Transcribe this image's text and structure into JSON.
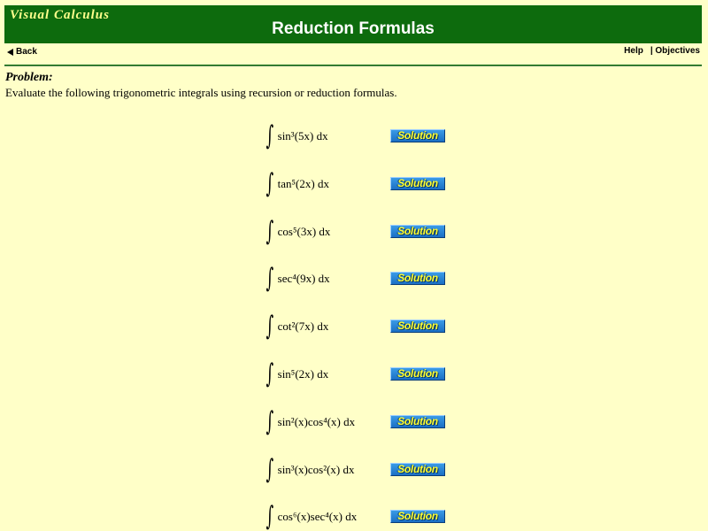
{
  "header": {
    "brand": "Visual Calculus",
    "title": "Reduction Formulas"
  },
  "nav": {
    "back_label": "Back",
    "help_label": "Help",
    "objectives_label": "| Objectives"
  },
  "problem": {
    "heading": "Problem:",
    "text": "Evaluate the following trigonometric integrals using recursion or reduction formulas."
  },
  "integrals": [
    {
      "integrand": "sin³(5x) dx",
      "solution_label": "Solution"
    },
    {
      "integrand": "tan⁵(2x) dx",
      "solution_label": "Solution"
    },
    {
      "integrand": "cos⁵(3x) dx",
      "solution_label": "Solution"
    },
    {
      "integrand": "sec⁴(9x) dx",
      "solution_label": "Solution"
    },
    {
      "integrand": "cot²(7x) dx",
      "solution_label": "Solution"
    },
    {
      "integrand": "sin⁵(2x) dx",
      "solution_label": "Solution"
    },
    {
      "integrand": "sin²(x)cos⁴(x) dx",
      "solution_label": "Solution"
    },
    {
      "integrand": "sin³(x)cos²(x) dx",
      "solution_label": "Solution"
    },
    {
      "integrand": "cos⁶(x)sec⁴(x) dx",
      "solution_label": "Solution"
    }
  ],
  "colors": {
    "background": "#ffffc8",
    "banner": "#0d6b0d",
    "button": "#1b6fc4",
    "button_text": "#ffff33"
  }
}
